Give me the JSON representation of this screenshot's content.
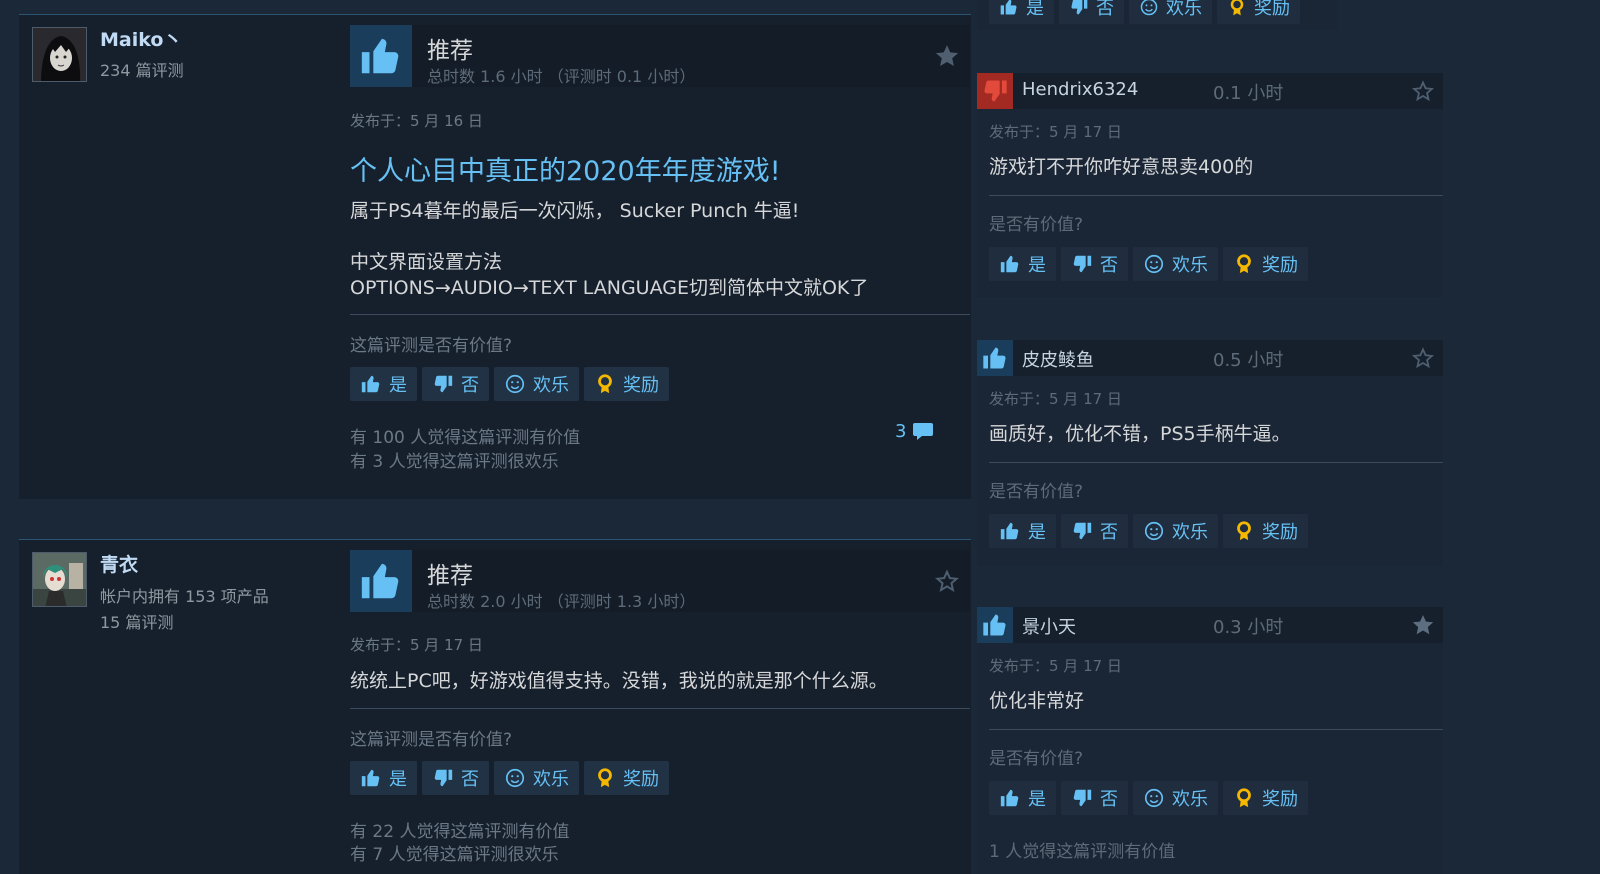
{
  "colors": {
    "accent": "#66c0f4",
    "background": "#1b2838",
    "card": "#16202d",
    "recommend_thumb": "#66c0f4",
    "not_recommend_thumb": "#c4302b",
    "award": "#f5b800"
  },
  "buttons": {
    "yes": "是",
    "no": "否",
    "funny": "欢乐",
    "award": "奖励"
  },
  "main_reviews": [
    {
      "username": "Maiko丶",
      "user_stats": [
        "234 篇评测"
      ],
      "verdict": "推荐",
      "hours": "总时数 1.6 小时 （评测时 0.1 小时）",
      "posted": "发布于：5 月 16 日",
      "headline": "个人心目中真正的2020年年度游戏!",
      "body": [
        "属于PS4暮年的最后一次闪烁， Sucker Punch 牛逼!",
        "",
        "中文界面设置方法",
        "OPTIONS→AUDIO→TEXT LANGUAGE切到简体中文就OK了"
      ],
      "helpful_question": "这篇评测是否有价值?",
      "helpful_stat": "有 100 人觉得这篇评测有价值",
      "funny_stat": "有 3 人觉得这篇评测很欢乐",
      "comments": "3",
      "starred": true
    },
    {
      "username": "青衣",
      "user_stats": [
        "帐户内拥有 153 项产品",
        "15 篇评测"
      ],
      "verdict": "推荐",
      "hours": "总时数 2.0 小时 （评测时 1.3 小时）",
      "posted": "发布于：5 月 17 日",
      "body": [
        "统统上PC吧，好游戏值得支持。没错，我说的就是那个什么源。"
      ],
      "helpful_question": "这篇评测是否有价值?",
      "helpful_stat": "有 22 人觉得这篇评测有价值",
      "funny_stat": "有 7 人觉得这篇评测很欢乐",
      "starred": false
    }
  ],
  "side_reviews": [
    {
      "username": "Hendrix6324",
      "hours": "0.1 小时",
      "recommended": false,
      "posted": "发布于：5 月 17 日",
      "text": "游戏打不开你咋好意思卖400的",
      "question": "是否有价值?",
      "starred": false
    },
    {
      "username": "皮皮鲮鱼",
      "hours": "0.5 小时",
      "recommended": true,
      "posted": "发布于：5 月 17 日",
      "text": "画质好，优化不错，PS5手柄牛逼。",
      "question": "是否有价值?",
      "starred": false
    },
    {
      "username": "景小天",
      "hours": "0.3 小时",
      "recommended": true,
      "posted": "发布于：5 月 17 日",
      "text": "优化非常好",
      "question": "是否有价值?",
      "stat": "1 人觉得这篇评测有价值",
      "starred": true
    }
  ],
  "icons": {
    "thumbs_up": "thumbs-up-icon",
    "thumbs_down": "thumbs-down-icon",
    "smile": "smile-icon",
    "award": "award-icon",
    "star": "star-icon",
    "comment": "comment-icon"
  }
}
